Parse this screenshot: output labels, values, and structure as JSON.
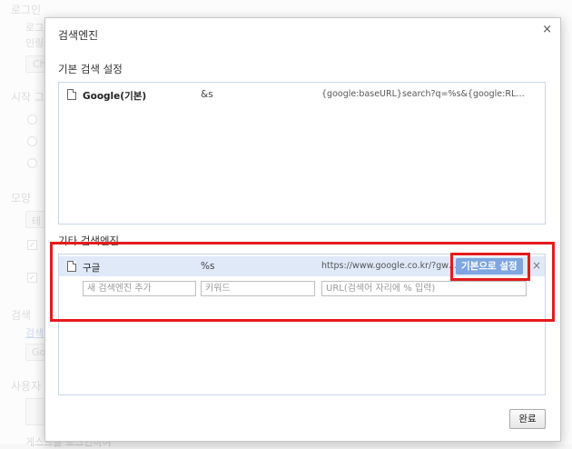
{
  "background": {
    "section_login": "로그인",
    "login_text1": "로그",
    "login_text2": "인링",
    "login_button": "Ch",
    "section_startup": "시작 그",
    "section_appearance": "모양",
    "appearance_button": "테",
    "section_search": "검색",
    "search_link": "검색",
    "search_button": "Go",
    "section_users": "사용자",
    "bottom_text": "게스트를 로그인하여"
  },
  "dialog": {
    "title": "검색엔진",
    "close_glyph": "×",
    "default_section_label": "기본 검색 설정",
    "default_engines": [
      {
        "name": "Google(기본)",
        "keyword": "&s",
        "url": "{google:baseURL}search?q=%s&{google:RLZ}{goog..."
      }
    ],
    "other_section_label": "기타 검색엔진",
    "other_engines": [
      {
        "name": "구글",
        "keyword": "%s",
        "url": "https://www.google.co.kr/?gws...",
        "make_default_label": "기본으로 설정",
        "remove_glyph": "×"
      }
    ],
    "add_row": {
      "name_placeholder": "새 검색엔진 추가",
      "keyword_placeholder": "키워드",
      "url_placeholder": "URL(검색어 자리에 % 입력)"
    },
    "done_label": "완료"
  },
  "colors": {
    "highlight_red": "#e31c1c",
    "selected_row": "#dfe9f8",
    "default_button": "#7fa6e0"
  }
}
